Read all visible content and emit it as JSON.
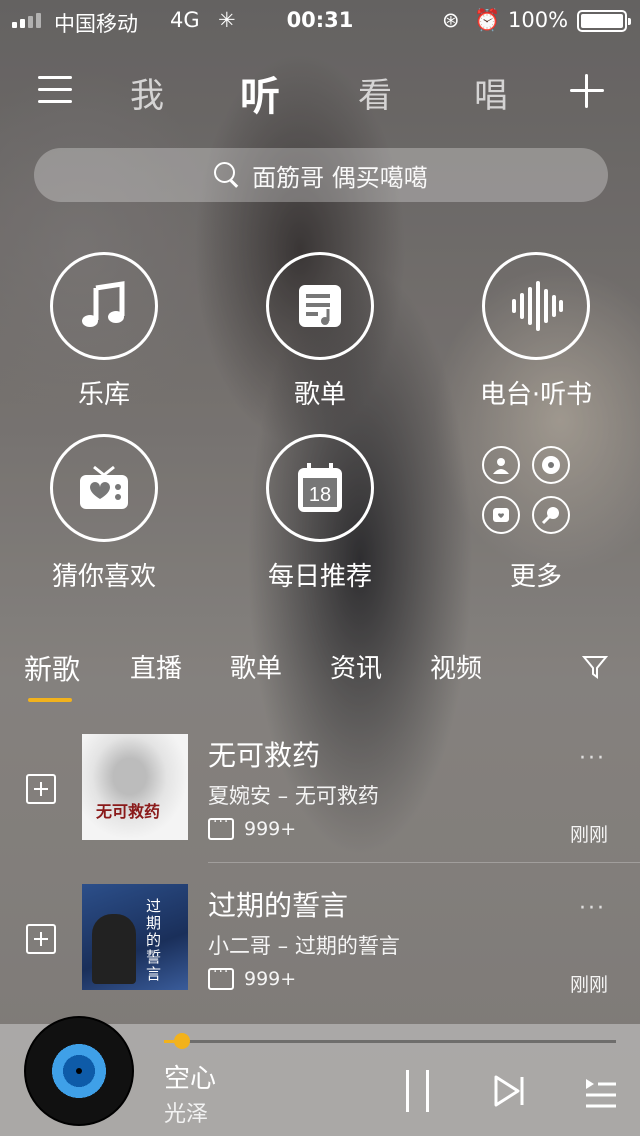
{
  "status_bar": {
    "carrier": "中国移动",
    "network": "4G",
    "time": "00:31",
    "battery": "100%"
  },
  "nav": {
    "tabs": [
      "我",
      "听",
      "看",
      "唱"
    ],
    "active_tab": "听"
  },
  "search": {
    "placeholder": "面筋哥 偶买噶噶"
  },
  "grid": [
    {
      "label": "乐库",
      "icon": "music-note-icon"
    },
    {
      "label": "歌单",
      "icon": "playlist-icon"
    },
    {
      "label": "电台·听书",
      "icon": "radio-wave-icon"
    },
    {
      "label": "猜你喜欢",
      "icon": "heart-radio-icon"
    },
    {
      "label": "每日推荐",
      "icon": "calendar-icon",
      "calendar_day": "18"
    },
    {
      "label": "更多",
      "icon": "more-grid-icon"
    }
  ],
  "content_tabs": [
    "新歌",
    "直播",
    "歌单",
    "资讯",
    "视频"
  ],
  "active_content_tab": "新歌",
  "songs": [
    {
      "title": "无可救药",
      "subtitle": "夏婉安 – 无可救药",
      "comments": "999+",
      "time": "刚刚",
      "cover_text": "无可救药"
    },
    {
      "title": "过期的誓言",
      "subtitle": "小二哥 – 过期的誓言",
      "comments": "999+",
      "time": "刚刚",
      "cover_text": "过期的誓言"
    }
  ],
  "player": {
    "title": "空心",
    "artist": "光泽",
    "progress": 0.04
  },
  "colors": {
    "accent": "#f2b21c"
  }
}
